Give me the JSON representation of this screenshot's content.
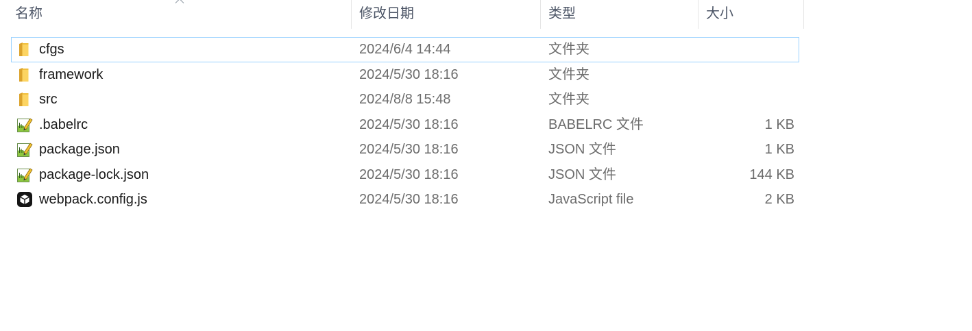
{
  "columns": {
    "name": "名称",
    "date": "修改日期",
    "type": "类型",
    "size": "大小",
    "sort_indicator": "sort-ascending-icon"
  },
  "files": [
    {
      "name": "cfgs",
      "modified": "2024/6/4 14:44",
      "type": "文件夹",
      "icon": "folder-icon",
      "focused": true
    },
    {
      "name": "framework",
      "modified": "2024/5/30 18:16",
      "type": "文件夹",
      "icon": "folder-icon"
    },
    {
      "name": "src",
      "modified": "2024/8/8 15:48",
      "type": "文件夹",
      "icon": "folder-icon"
    },
    {
      "name": ".babelrc",
      "modified": "2024/5/30 18:16",
      "type": "BABELRC 文件",
      "size": "1 KB",
      "icon": "text-file-icon"
    },
    {
      "name": "package.json",
      "modified": "2024/5/30 18:16",
      "type": "JSON 文件",
      "size": "1 KB",
      "icon": "text-file-icon"
    },
    {
      "name": "package-lock.json",
      "modified": "2024/5/30 18:16",
      "type": "JSON 文件",
      "size": "144 KB",
      "icon": "text-file-icon"
    },
    {
      "name": "webpack.config.js",
      "modified": "2024/5/30 18:16",
      "type": "JavaScript file",
      "size": "2 KB",
      "icon": "javascript-file-icon"
    }
  ],
  "colors": {
    "focus_border": "#99d1ff",
    "header_text": "#4c5566",
    "detail_text": "#6d6d6d",
    "name_text": "#1a1a1a",
    "separator": "#e5e5e5"
  }
}
